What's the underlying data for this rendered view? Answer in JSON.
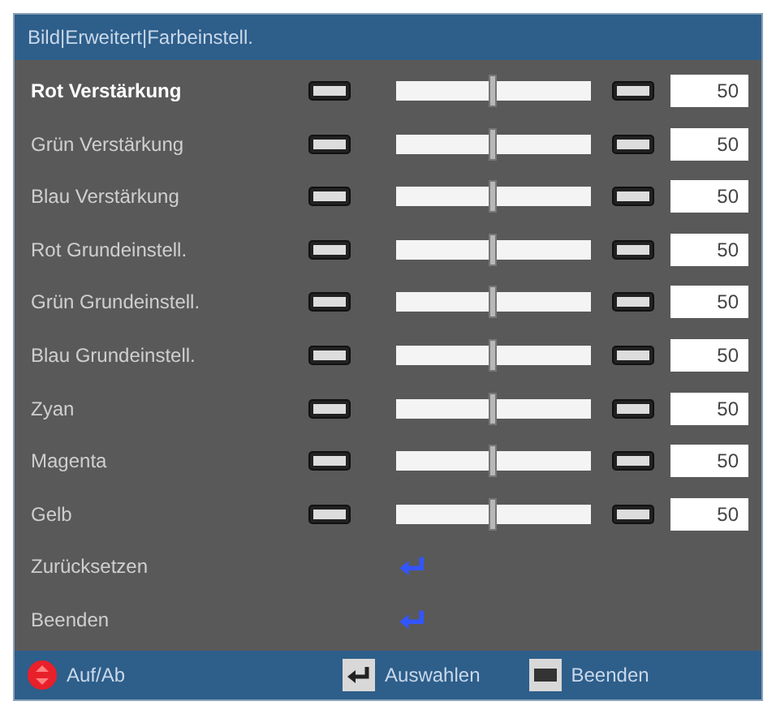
{
  "title": "Bild|Erweitert|Farbeinstell.",
  "rows": [
    {
      "kind": "slider",
      "label": "Rot Verstärkung",
      "level": 0.5,
      "value": "50",
      "selected": true
    },
    {
      "kind": "slider",
      "label": "Grün Verstärkung",
      "level": 0.5,
      "value": "50",
      "selected": false
    },
    {
      "kind": "slider",
      "label": "Blau Verstärkung",
      "level": 0.5,
      "value": "50",
      "selected": false
    },
    {
      "kind": "slider",
      "label": "Rot Grundeinstell.",
      "level": 0.5,
      "value": "50",
      "selected": false
    },
    {
      "kind": "slider",
      "label": "Grün Grundeinstell.",
      "level": 0.5,
      "value": "50",
      "selected": false
    },
    {
      "kind": "slider",
      "label": "Blau Grundeinstell.",
      "level": 0.5,
      "value": "50",
      "selected": false
    },
    {
      "kind": "slider",
      "label": "Zyan",
      "level": 0.5,
      "value": "50",
      "selected": false
    },
    {
      "kind": "slider",
      "label": "Magenta",
      "level": 0.5,
      "value": "50",
      "selected": false
    },
    {
      "kind": "slider",
      "label": "Gelb",
      "level": 0.5,
      "value": "50",
      "selected": false
    },
    {
      "kind": "action",
      "label": "Zurücksetzen",
      "selected": false
    },
    {
      "kind": "action",
      "label": "Beenden",
      "selected": false
    }
  ],
  "footer": [
    {
      "kind": "updown",
      "label": "Auf/Ab"
    },
    {
      "kind": "enter",
      "label": "Auswahlen"
    },
    {
      "kind": "menu",
      "label": "Beenden"
    }
  ]
}
